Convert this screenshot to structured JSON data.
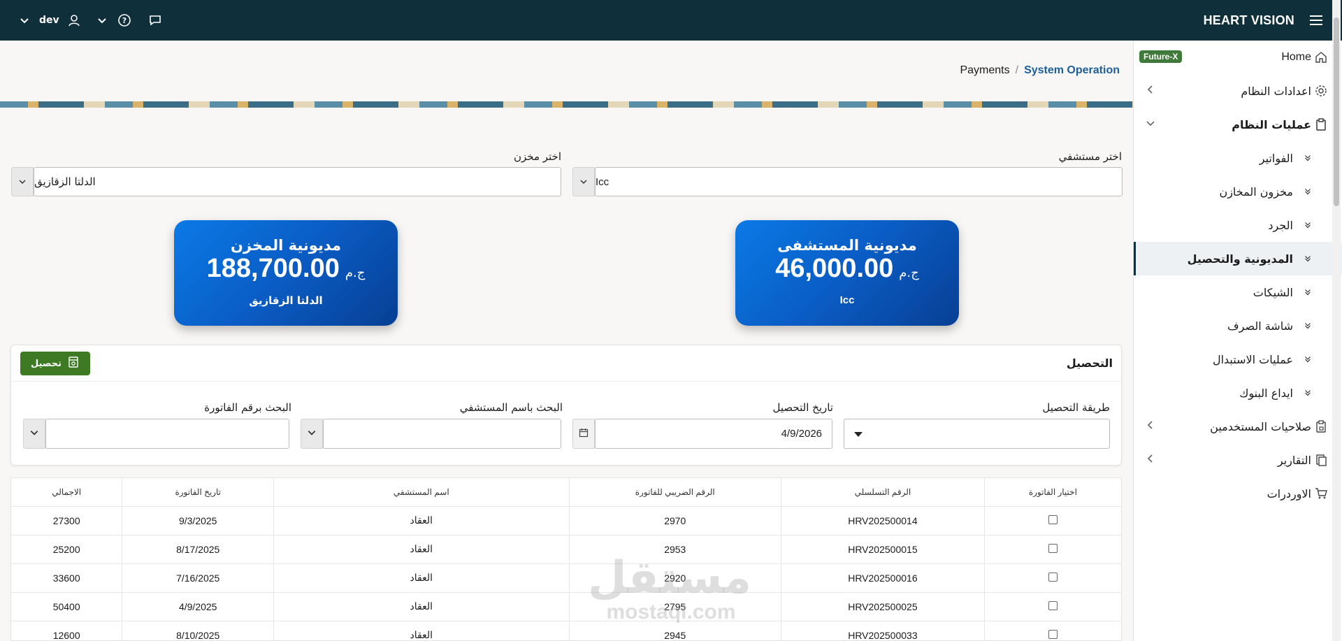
{
  "topbar": {
    "brand": "HEART VISION",
    "user": "dev"
  },
  "breadcrumb": {
    "parent": "Payments",
    "separator": "/",
    "current": "System Operation"
  },
  "sidebar": {
    "home": "Home",
    "badge": "Future-X",
    "items": [
      {
        "label": "اعدادات النظام"
      },
      {
        "label": "عمليات النظام"
      }
    ],
    "sub_items": [
      {
        "label": "الفواتير"
      },
      {
        "label": "مخزون المخازن"
      },
      {
        "label": "الجرد"
      },
      {
        "label": "المديونية والتحصيل"
      },
      {
        "label": "الشيكات"
      },
      {
        "label": "شاشة الصرف"
      },
      {
        "label": "عمليات الاستبدال"
      },
      {
        "label": "ايداع البنوك"
      }
    ],
    "bottom_items": [
      {
        "label": "صلاحيات المستخدمين"
      },
      {
        "label": "التقارير"
      },
      {
        "label": "الاوردرات"
      }
    ]
  },
  "filters": {
    "hospital_label": "اختر مستشفي",
    "hospital_value": "Icc",
    "store_label": "اختر مخزن",
    "store_value": "الدلتا الزقازيق"
  },
  "cards": {
    "hospital": {
      "title": "مديونية المستشفى",
      "amount": "46,000.00",
      "currency": "ج.م",
      "name": "Icc"
    },
    "store": {
      "title": "مديونية المخزن",
      "amount": "188,700.00",
      "currency": "ج.م",
      "name": "الدلتا الزقازيق"
    }
  },
  "collection": {
    "title": "التحصيل",
    "button": "تحصيل",
    "method_label": "طريقة التحصيل",
    "method_value": "",
    "date_label": "تاريخ التحصيل",
    "date_value": "4/9/2026",
    "hospital_search_label": "البحث باسم المستشفي",
    "hospital_search_value": "",
    "invoice_search_label": "البحث برقم الفاتورة",
    "invoice_search_value": ""
  },
  "table": {
    "headers": [
      "اختيار الفاتورة",
      "الرقم التسلسلي",
      "الرقم الضريبي للفاتورة",
      "اسم المستشفي",
      "تاريخ الفاتورة",
      "الاجمالي"
    ],
    "rows": [
      {
        "serial": "HRV202500014",
        "tax": "2970",
        "hospital": "العقاد",
        "date": "9/3/2025",
        "total": "27300"
      },
      {
        "serial": "HRV202500015",
        "tax": "2953",
        "hospital": "العقاد",
        "date": "8/17/2025",
        "total": "25200"
      },
      {
        "serial": "HRV202500016",
        "tax": "2920",
        "hospital": "العقاد",
        "date": "7/16/2025",
        "total": "33600"
      },
      {
        "serial": "HRV202500025",
        "tax": "2795",
        "hospital": "العقاد",
        "date": "4/9/2025",
        "total": "50400"
      },
      {
        "serial": "HRV202500033",
        "tax": "2945",
        "hospital": "العقاد",
        "date": "8/10/2025",
        "total": "12600"
      }
    ]
  },
  "watermark": {
    "arabic": "مستقل",
    "latin": "mostaql.com"
  },
  "colors": {
    "topbar": "#0f2f3a",
    "card": "#0a5cc4",
    "collect_button": "#3d7a23",
    "badge": "#3f7a3a",
    "breadcrumb_active": "#1d5f9a"
  }
}
